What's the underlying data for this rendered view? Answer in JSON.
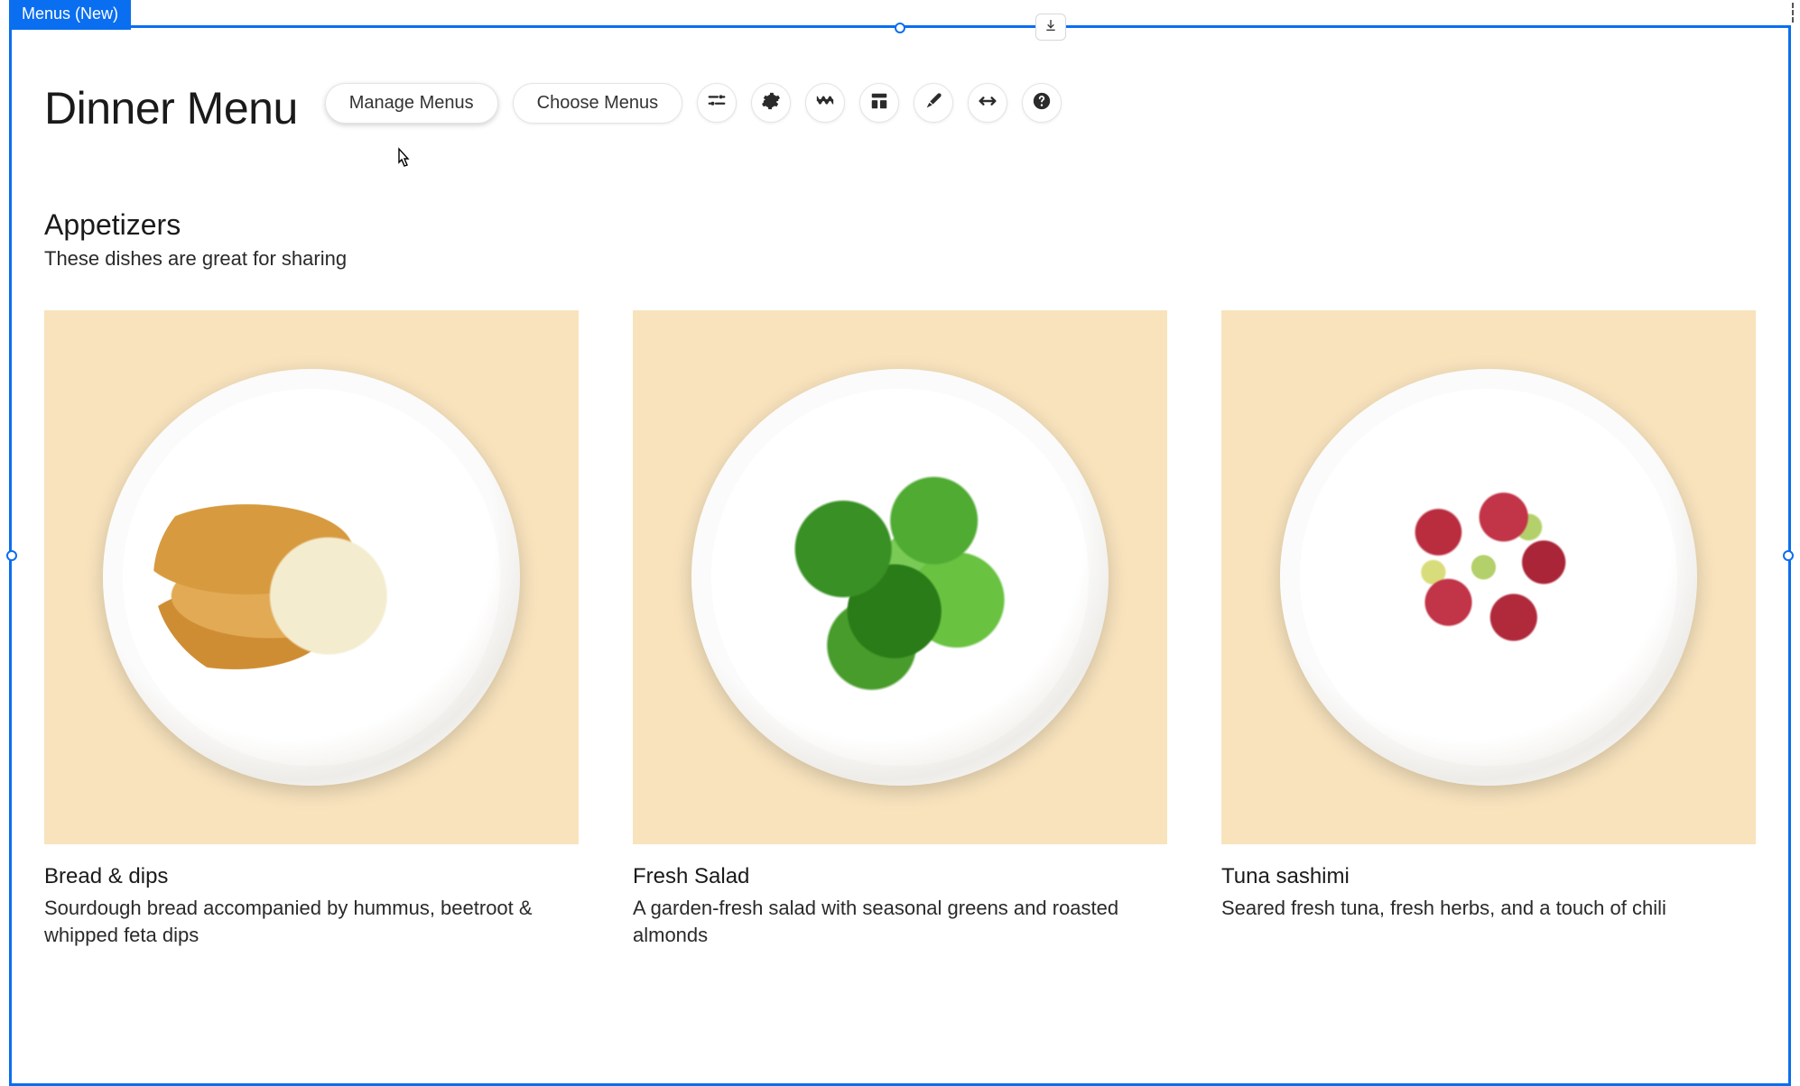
{
  "editor": {
    "tag_label": "Menus (New)"
  },
  "toolbar": {
    "manage_label": "Manage Menus",
    "choose_label": "Choose Menus",
    "icons": {
      "filters": "filters-icon",
      "settings": "gear-icon",
      "design": "wave-icon",
      "layout": "layout-icon",
      "style": "brush-icon",
      "stretch": "stretch-icon",
      "help": "help-icon"
    }
  },
  "page": {
    "title": "Dinner Menu"
  },
  "section": {
    "title": "Appetizers",
    "subtitle": "These dishes are great for sharing"
  },
  "items": [
    {
      "name": "Bread & dips",
      "desc": "Sourdough bread accompanied by hummus, beetroot & whipped feta dips",
      "plate": "bread"
    },
    {
      "name": "Fresh Salad",
      "desc": "A garden-fresh salad with seasonal greens and roasted almonds",
      "plate": "salad"
    },
    {
      "name": "Tuna sashimi",
      "desc": "Seared fresh tuna, fresh herbs, and a touch of chili",
      "plate": "tuna"
    }
  ]
}
